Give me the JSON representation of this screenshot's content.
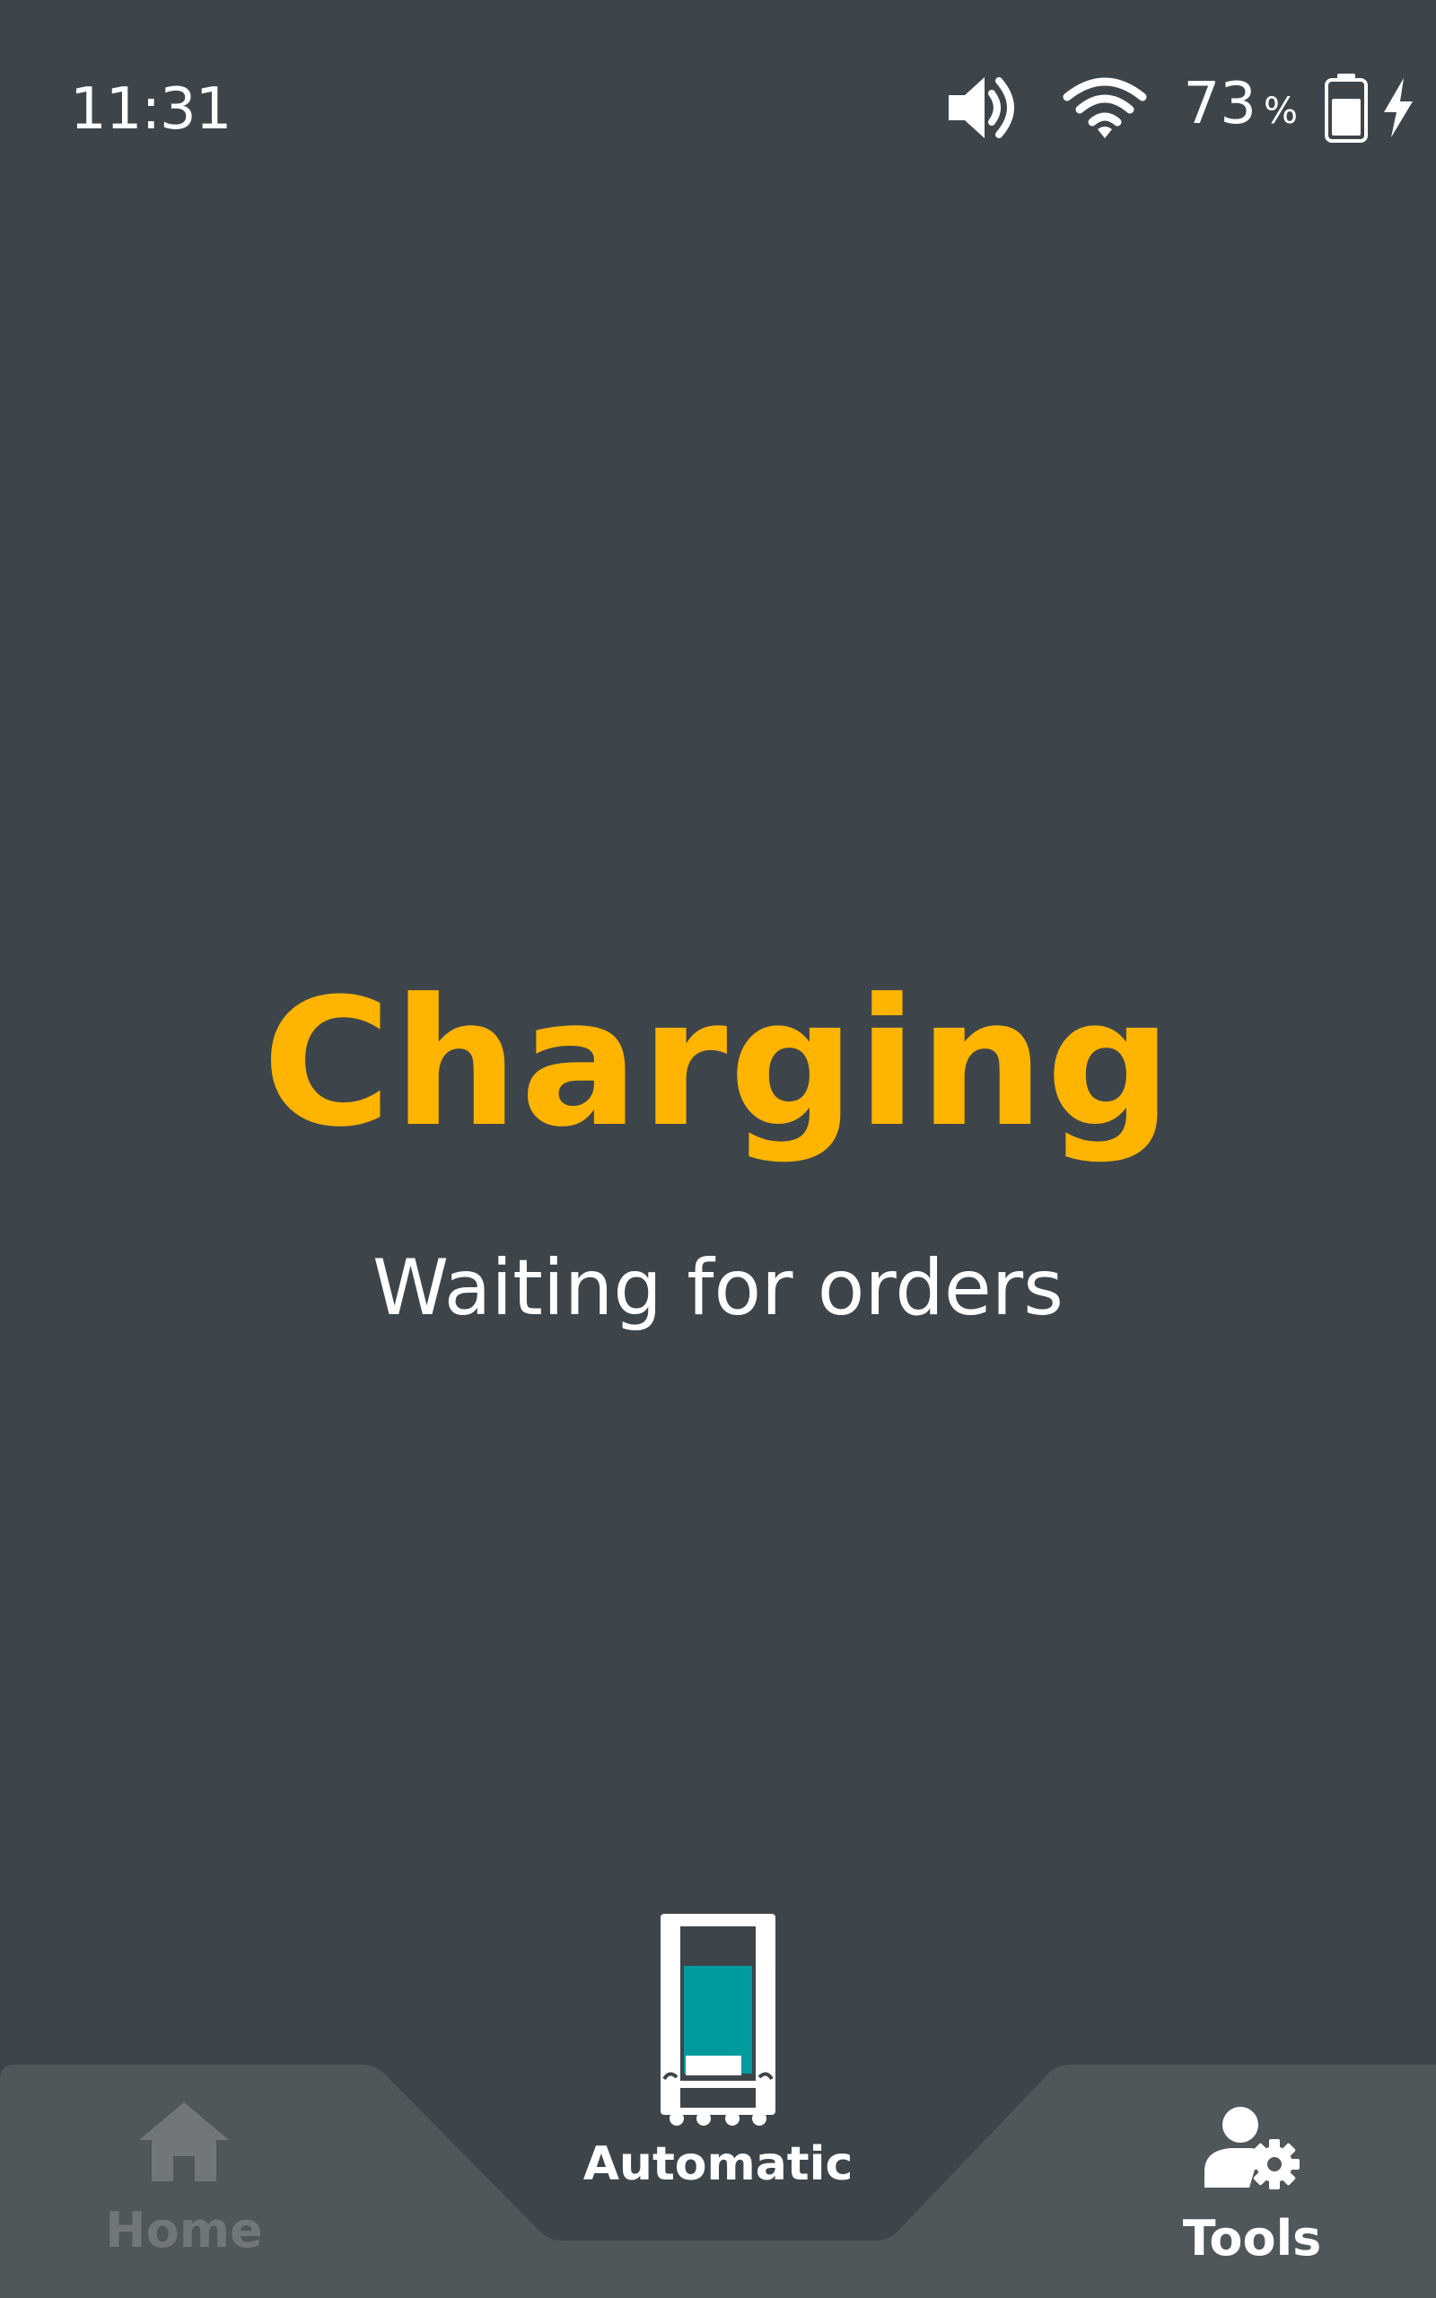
{
  "status_bar": {
    "time": "11:31",
    "battery_percent": "73",
    "percent_sign": "%",
    "battery_level": 0.73,
    "icons": [
      "volume-icon",
      "wifi-icon",
      "battery-icon",
      "charging-bolt-icon"
    ]
  },
  "main": {
    "title": "Charging",
    "subtitle": "Waiting for orders"
  },
  "bottom_nav": {
    "items": [
      {
        "label": "Home",
        "icon": "home-icon",
        "state": "inactive"
      },
      {
        "label": "Automatic",
        "icon": "vehicle-icon",
        "state": "active"
      },
      {
        "label": "Tools",
        "icon": "user-gear-icon",
        "state": "enabled"
      }
    ]
  },
  "colors": {
    "background": "#3d454b",
    "nav_background": "#4f575b",
    "accent": "#ffb400",
    "vehicle_teal": "#009b9c",
    "inactive_text": "#707679"
  }
}
